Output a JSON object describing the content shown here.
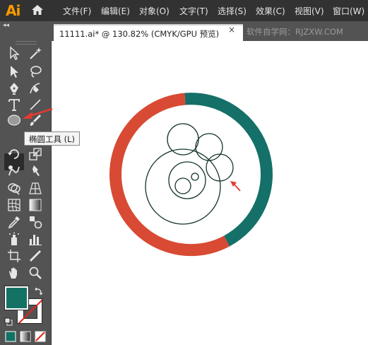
{
  "app": {
    "logo_text": "Ai"
  },
  "menus": [
    {
      "label": "文件(F)"
    },
    {
      "label": "编辑(E)"
    },
    {
      "label": "对象(O)"
    },
    {
      "label": "文字(T)"
    },
    {
      "label": "选择(S)"
    },
    {
      "label": "效果(C)"
    },
    {
      "label": "视图(V)"
    },
    {
      "label": "窗口(W)"
    }
  ],
  "document": {
    "tab_title": "11111.ai* @ 130.82% (CMYK/GPU 预览)",
    "close_glyph": "×",
    "watermark": "软件自学网：RJZXW.COM"
  },
  "toolbar": {
    "collapse_glyph": "◂◂",
    "tooltip": "椭圆工具 (L)",
    "active_tool": "ellipse-tool",
    "fill_color": "#137264",
    "stroke_color": "none"
  },
  "colors": {
    "ring_red": "#d84a33",
    "ring_teal": "#147068",
    "circle_stroke": "#14332c",
    "arrow_red": "#e23b33",
    "menubar_bg": "#323232",
    "panel_bg": "#535353"
  },
  "icons": [
    "home-icon",
    "selection-icon",
    "direct-selection-icon",
    "magic-wand-icon",
    "lasso-icon",
    "pen-icon",
    "curvature-icon",
    "type-icon",
    "line-segment-icon",
    "ellipse-icon",
    "paintbrush-icon",
    "rotate-icon",
    "scale-icon",
    "warp-icon",
    "puppet-warp-icon",
    "free-transform-icon",
    "shape-builder-icon",
    "perspective-grid-icon",
    "mesh-icon",
    "gradient-icon",
    "eyedropper-icon",
    "blend-icon",
    "symbol-sprayer-icon",
    "column-graph-icon",
    "artboard-icon",
    "slice-icon",
    "hand-icon",
    "zoom-icon",
    "swap-icon",
    "default-colors-icon",
    "color-mode-icon",
    "gradient-mode-icon",
    "none-mode-icon"
  ]
}
